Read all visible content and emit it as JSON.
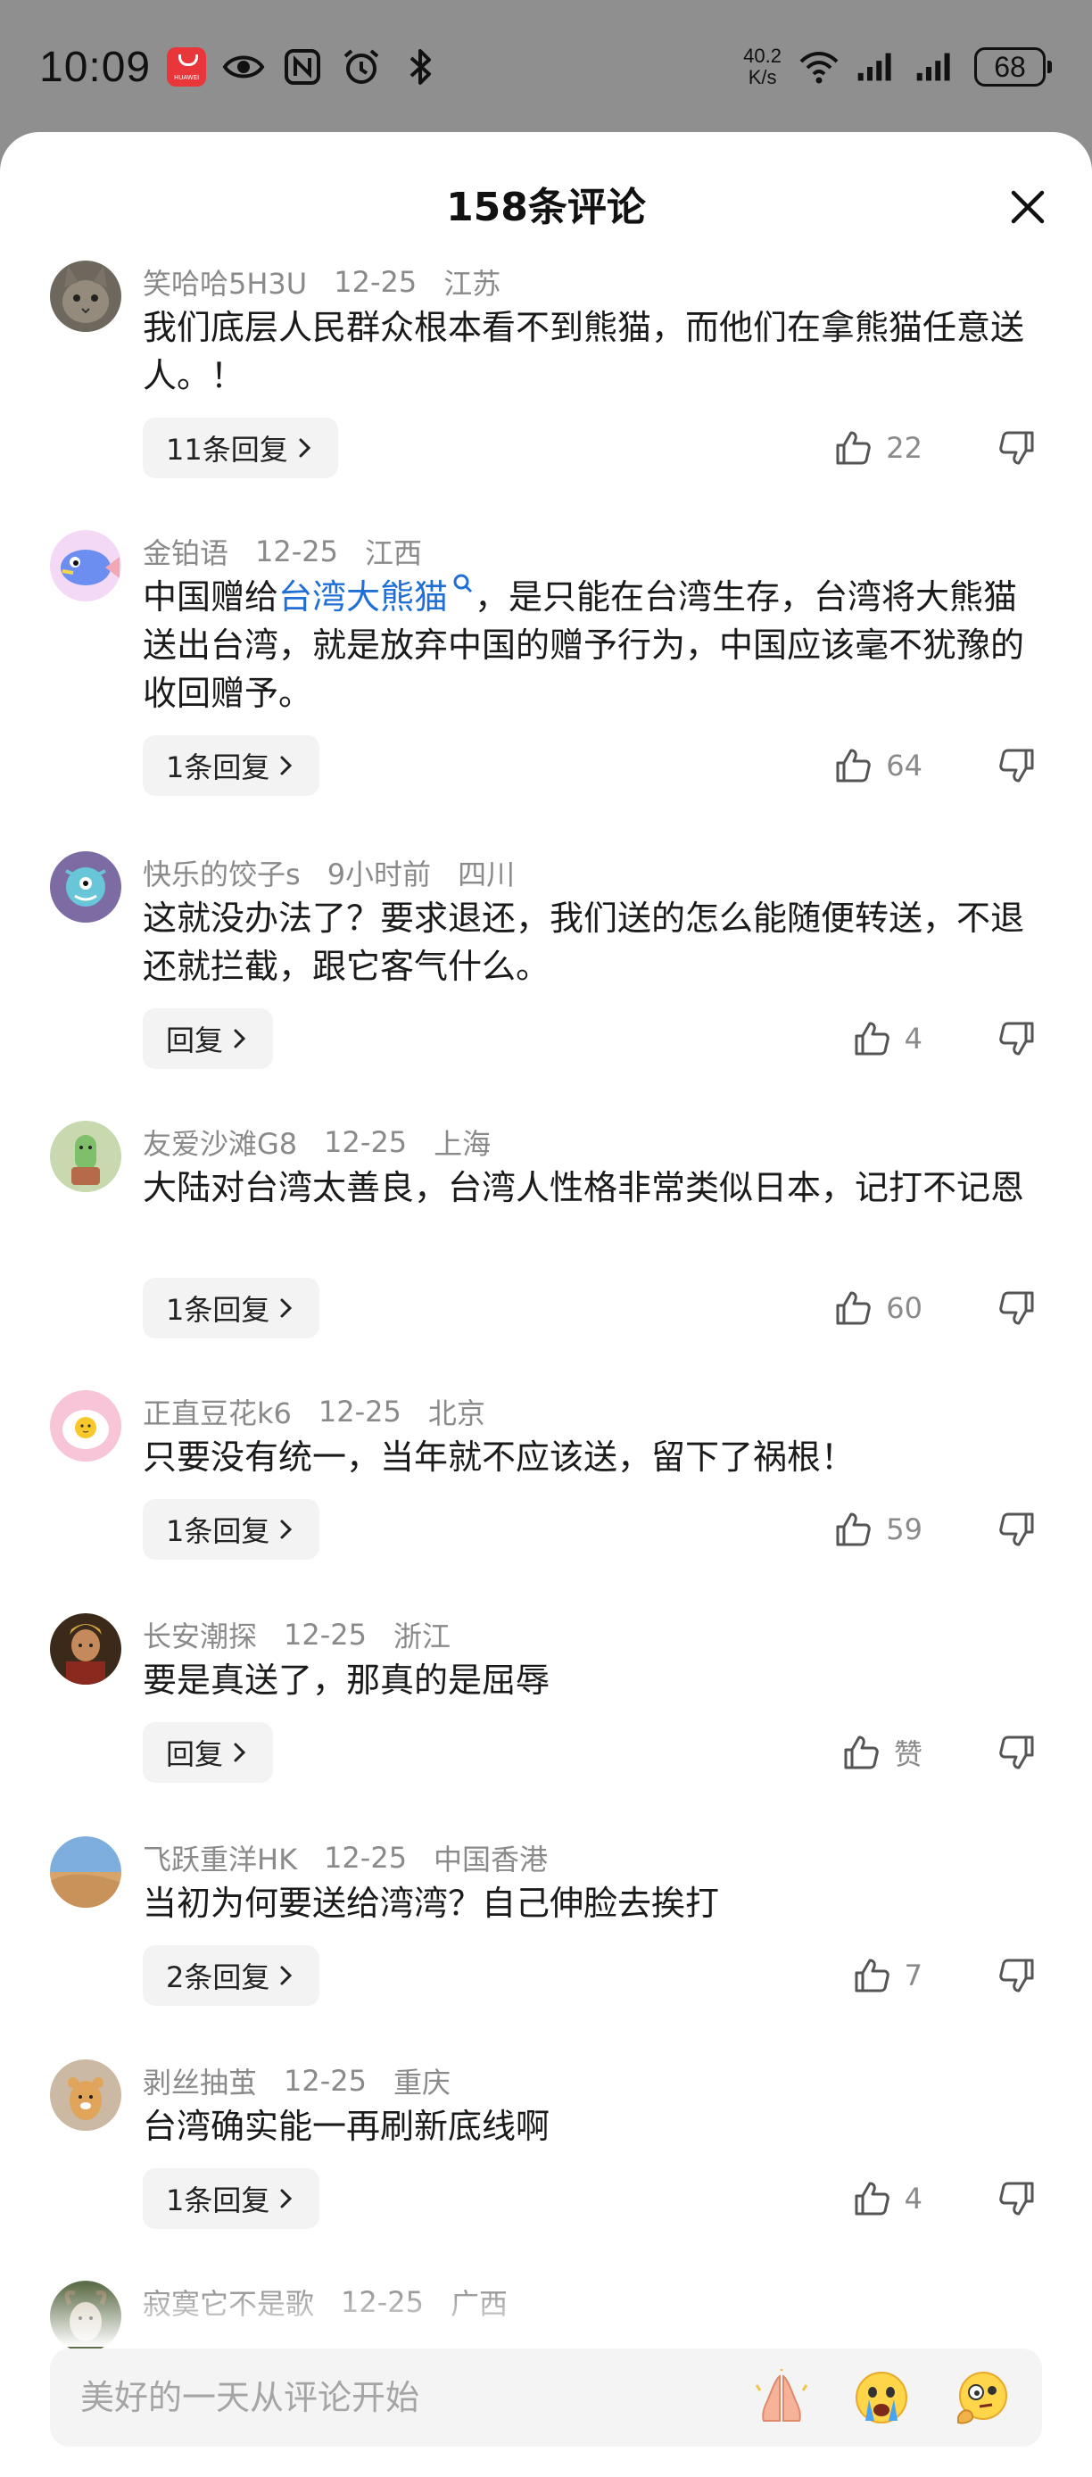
{
  "status_bar": {
    "time": "10:09",
    "huawei_label": "HUAWEI",
    "net_speed_value": "40.2",
    "net_speed_unit": "K/s",
    "battery": "68"
  },
  "panel": {
    "title": "158条评论"
  },
  "comments": [
    {
      "user": "笑哈哈5H3U",
      "date": "12-25",
      "location": "江苏",
      "text_before": "我们底层人民群众根本看不到熊猫，而他们在拿熊猫任意送人。！",
      "link": "",
      "text_after": "",
      "replies": "11条回复",
      "likes": "22",
      "avatar": "cat"
    },
    {
      "user": "金铂语",
      "date": "12-25",
      "location": "江西",
      "text_before": "中国赠给",
      "link": "台湾大熊猫",
      "text_after": "，是只能在台湾生存，台湾将大熊猫送出台湾，就是放弃中国的赠予行为，中国应该毫不犹豫的收回赠予。",
      "replies": "1条回复",
      "likes": "64",
      "avatar": "fish"
    },
    {
      "user": "快乐的饺子s",
      "date": "9小时前",
      "location": "四川",
      "text_before": "这就没办法了？要求退还，我们送的怎么能随便转送，不退还就拦截，跟它客气什么。",
      "link": "",
      "text_after": "",
      "replies": "回复",
      "likes": "4",
      "avatar": "monster"
    },
    {
      "user": "友爱沙滩G8",
      "date": "12-25",
      "location": "上海",
      "text_before": "大陆对台湾太善良，台湾人性格非常类似日本，记打不记恩",
      "link": "",
      "text_after": "",
      "replies": "1条回复",
      "likes": "60",
      "avatar": "cactus"
    },
    {
      "user": "正直豆花k6",
      "date": "12-25",
      "location": "北京",
      "text_before": "只要没有统一，当年就不应该送，留下了祸根！",
      "link": "",
      "text_after": "",
      "replies": "1条回复",
      "likes": "59",
      "avatar": "egg"
    },
    {
      "user": "长安潮探",
      "date": "12-25",
      "location": "浙江",
      "text_before": "要是真送了，那真的是屈辱",
      "link": "",
      "text_after": "",
      "replies": "回复",
      "likes": "赞",
      "avatar": "warrior"
    },
    {
      "user": "飞跃重洋HK",
      "date": "12-25",
      "location": "中国香港",
      "text_before": "当初为何要送给湾湾？自己伸脸去挨打",
      "link": "",
      "text_after": "",
      "replies": "2条回复",
      "likes": "7",
      "avatar": "desert"
    },
    {
      "user": "剥丝抽茧",
      "date": "12-25",
      "location": "重庆",
      "text_before": "台湾确实能一再刷新底线啊",
      "link": "",
      "text_after": "",
      "replies": "1条回复",
      "likes": "4",
      "avatar": "bear"
    },
    {
      "user": "寂寞它不是歌",
      "date": "12-25",
      "location": "广西",
      "text_before": "",
      "link": "",
      "text_after": "",
      "replies": "",
      "likes": "",
      "avatar": "goat"
    }
  ],
  "input": {
    "placeholder": "美好的一天从评论开始"
  },
  "emojis": [
    "pray-emoji",
    "crying-emoji",
    "thinking-emoji"
  ]
}
